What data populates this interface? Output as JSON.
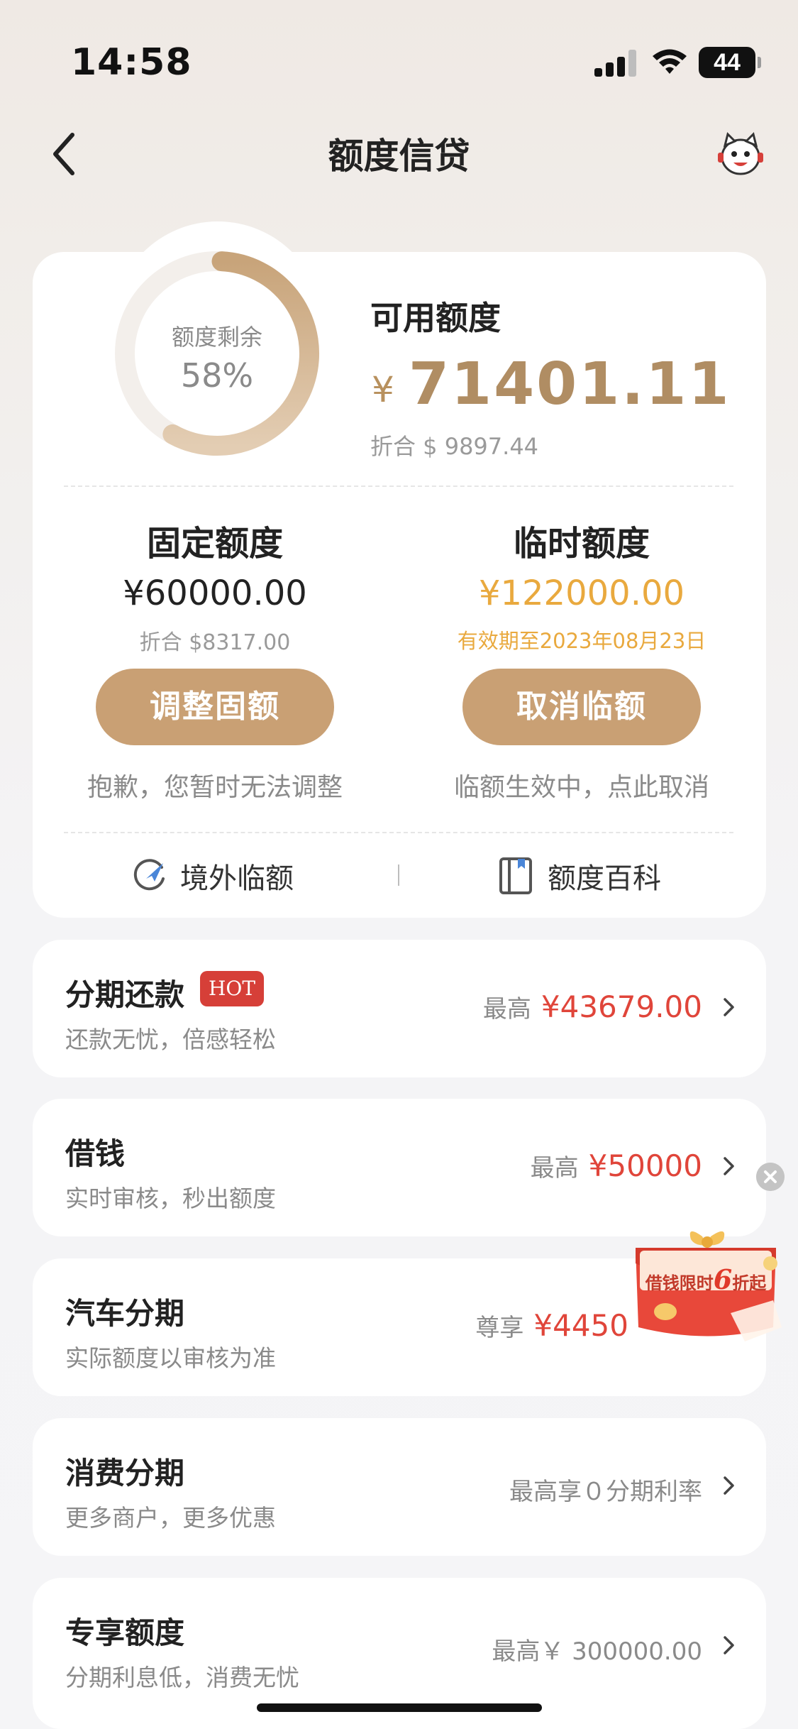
{
  "status_bar": {
    "time": "14:58",
    "battery": "44"
  },
  "nav": {
    "title": "额度信贷"
  },
  "quota": {
    "ring_label": "额度剩余",
    "ring_percent": "58%",
    "ring_fraction": 0.58,
    "available_label": "可用额度",
    "currency_symbol": "¥",
    "available_amount": "71401.11",
    "available_usd": "折合 $ 9897.44",
    "fixed": {
      "title": "固定额度",
      "amount": "¥60000.00",
      "sub": "折合 $8317.00",
      "button": "调整固额",
      "note": "抱歉，您暂时无法调整"
    },
    "temp": {
      "title": "临时额度",
      "amount": "¥122000.00",
      "sub": "有效期至2023年08月23日",
      "button": "取消临额",
      "note": "临额生效中，点此取消"
    },
    "links": {
      "overseas": "境外临额",
      "wiki": "额度百科"
    }
  },
  "list": [
    {
      "title": "分期还款",
      "badge": "HOT",
      "subtitle": "还款无忧，倍感轻松",
      "right_label": "最高",
      "right_value": "¥43679.00"
    },
    {
      "title": "借钱",
      "subtitle": "实时审核，秒出额度",
      "right_label": "最高",
      "right_value": "¥50000"
    },
    {
      "title": "汽车分期",
      "subtitle": "实际额度以审核为准",
      "right_label": "尊享",
      "right_value": "¥4450"
    },
    {
      "title": "消费分期",
      "subtitle": "更多商户，更多优惠",
      "right_label": "最高享０分期利率",
      "right_value": ""
    },
    {
      "title": "专享额度",
      "subtitle": "分期利息低，消费无忧",
      "right_label": "最高￥ 300000.00",
      "right_value": ""
    }
  ],
  "promo": {
    "text_a": "借钱限时",
    "text_big": "6",
    "text_b": "折起"
  },
  "colors": {
    "accent_gold": "#c9a074",
    "amount_gold": "#b08d63",
    "temp_orange": "#e9a93e",
    "red": "#e0453a"
  }
}
